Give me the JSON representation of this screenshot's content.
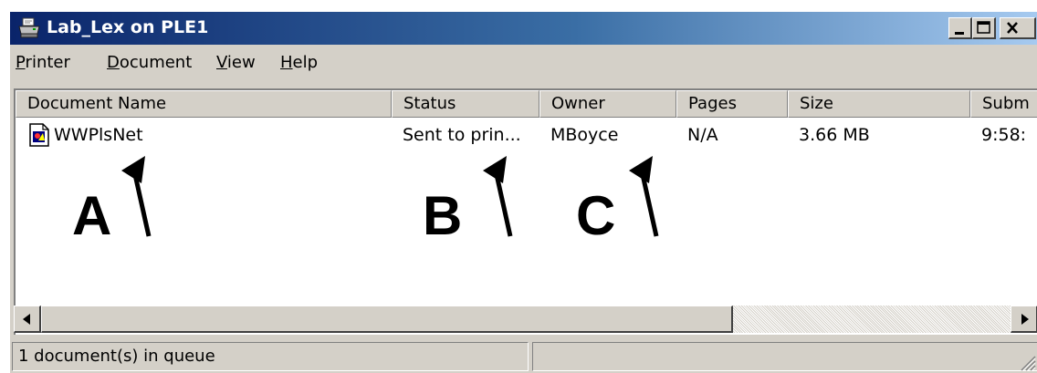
{
  "window": {
    "title": "Lab_Lex on PLE1",
    "controls": {
      "minimize_icon": "minimize-icon",
      "maximize_icon": "maximize-icon",
      "close_icon": "close-icon"
    }
  },
  "menu": [
    {
      "label": "Printer",
      "accel": "P",
      "rest": "rinter"
    },
    {
      "label": "Document",
      "accel": "D",
      "rest": "ocument"
    },
    {
      "label": "View",
      "accel": "V",
      "rest": "iew"
    },
    {
      "label": "Help",
      "accel": "H",
      "rest": "elp"
    }
  ],
  "columns": [
    "Document Name",
    "Status",
    "Owner",
    "Pages",
    "Size",
    "Subm"
  ],
  "rows": [
    {
      "document_name": "WWPlsNet",
      "status": "Sent to prin...",
      "owner": "MBoyce",
      "pages": "N/A",
      "size": "3.66 MB",
      "submitted": "9:58:"
    }
  ],
  "annotations": [
    "A",
    "B",
    "C"
  ],
  "status_bar": {
    "text": "1 document(s) in queue",
    "second_pane": ""
  },
  "icons": {
    "title": "printer-icon",
    "document": "document-icon",
    "scroll_left": "scroll-left-icon",
    "scroll_right": "scroll-right-icon",
    "resize_grip": "resize-grip-icon",
    "annotation_arrow": "arrow-up-icon"
  },
  "colors": {
    "titlebar_start": "#0a246a",
    "titlebar_end": "#a6caf0",
    "face": "#d4d0c8"
  }
}
